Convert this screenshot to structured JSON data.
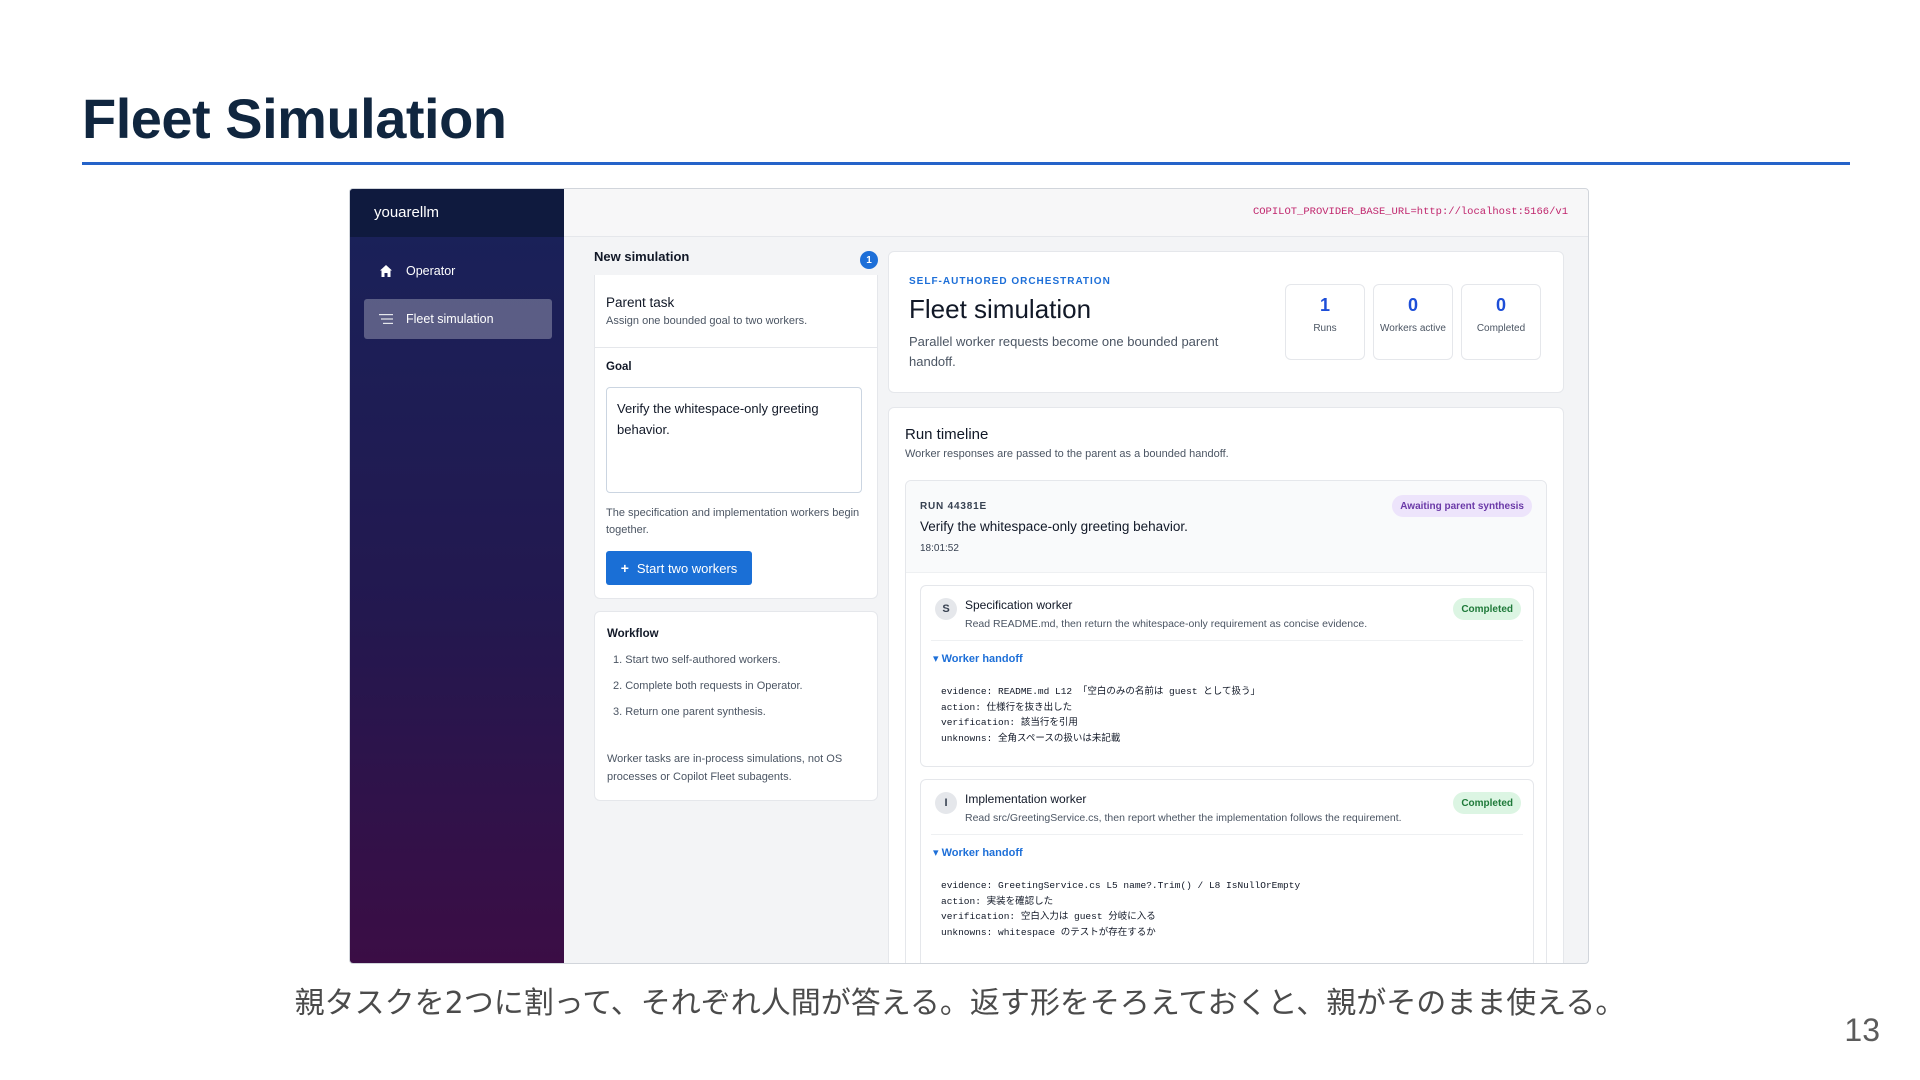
{
  "slide": {
    "title": "Fleet Simulation",
    "caption": "親タスクを2つに割って、それぞれ人間が答える。返す形をそろえておくと、親がそのまま使える。",
    "page_number": "13"
  },
  "app": {
    "brand": "youarellm",
    "env_var": "COPILOT_PROVIDER_BASE_URL=http://localhost:5166/v1"
  },
  "sidebar": {
    "items": [
      {
        "label": "Operator",
        "icon": "home-icon"
      },
      {
        "label": "Fleet simulation",
        "icon": "list-icon"
      }
    ]
  },
  "new_simulation": {
    "title": "New simulation",
    "badge": "1",
    "parent_task_label": "Parent task",
    "parent_task_sub": "Assign one bounded goal to two workers.",
    "goal_label": "Goal",
    "goal_value": "Verify the whitespace-only greeting behavior.",
    "note": "The specification and implementation workers begin together.",
    "start_button": "Start two workers"
  },
  "workflow": {
    "title": "Workflow",
    "steps": [
      "1. Start two self-authored workers.",
      "2. Complete both requests in Operator.",
      "3. Return one parent synthesis."
    ],
    "note": "Worker tasks are in-process simulations, not OS processes or Copilot Fleet subagents."
  },
  "summary": {
    "kicker": "SELF-AUTHORED ORCHESTRATION",
    "title": "Fleet simulation",
    "description": "Parallel worker requests become one bounded parent handoff.",
    "stats": [
      {
        "value": "1",
        "label": "Runs"
      },
      {
        "value": "0",
        "label": "Workers active"
      },
      {
        "value": "0",
        "label": "Completed"
      }
    ]
  },
  "timeline": {
    "title": "Run timeline",
    "subtitle": "Worker responses are passed to the parent as a bounded handoff.",
    "run": {
      "id": "RUN 44381E",
      "goal": "Verify the whitespace-only greeting behavior.",
      "time": "18:01:52",
      "status": "Awaiting parent synthesis"
    },
    "workers": [
      {
        "initial": "S",
        "name": "Specification worker",
        "description": "Read README.md, then return the whitespace-only requirement as concise evidence.",
        "status": "Completed",
        "handoff_label": "▾ Worker handoff",
        "handoff": "evidence: README.md L12 「空白のみの名前は guest として扱う」\naction: 仕様行を抜き出した\nverification: 該当行を引用\nunknowns: 全角スペースの扱いは未記載"
      },
      {
        "initial": "I",
        "name": "Implementation worker",
        "description": "Read src/GreetingService.cs, then report whether the implementation follows the requirement.",
        "status": "Completed",
        "handoff_label": "▾ Worker handoff",
        "handoff": "evidence: GreetingService.cs L5 name?.Trim() / L8 IsNullOrEmpty\naction: 実装を確認した\nverification: 空白入力は guest 分岐に入る\nunknowns: whitespace のテストが存在するか"
      }
    ]
  },
  "colors": {
    "accent": "#1d6fd8",
    "title_rule": "#2563c9",
    "sidebar_top": "#19225a",
    "sidebar_bottom": "#3b0d45",
    "completed_bg": "#dcf5e3",
    "awaiting_bg": "#ede4fb"
  }
}
